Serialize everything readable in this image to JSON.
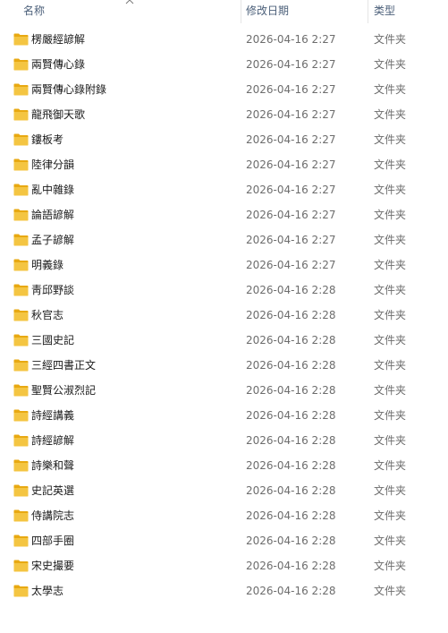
{
  "columns": {
    "name": "名称",
    "date": "修改日期",
    "type": "类型"
  },
  "folder_icon": "folder-icon",
  "folder_color": "#f4c542",
  "files": [
    {
      "name": "楞嚴經諺解",
      "date": "2026-04-16 2:27",
      "type": "文件夹"
    },
    {
      "name": "兩賢傳心錄",
      "date": "2026-04-16 2:27",
      "type": "文件夹"
    },
    {
      "name": "兩賢傳心錄附錄",
      "date": "2026-04-16 2:27",
      "type": "文件夹"
    },
    {
      "name": "龍飛御天歌",
      "date": "2026-04-16 2:27",
      "type": "文件夹"
    },
    {
      "name": "鏤板考",
      "date": "2026-04-16 2:27",
      "type": "文件夹"
    },
    {
      "name": "陸律分韻",
      "date": "2026-04-16 2:27",
      "type": "文件夹"
    },
    {
      "name": "亂中雜錄",
      "date": "2026-04-16 2:27",
      "type": "文件夹"
    },
    {
      "name": "論語諺解",
      "date": "2026-04-16 2:27",
      "type": "文件夹"
    },
    {
      "name": "孟子諺解",
      "date": "2026-04-16 2:27",
      "type": "文件夹"
    },
    {
      "name": "明義錄",
      "date": "2026-04-16 2:27",
      "type": "文件夹"
    },
    {
      "name": "靑邱野談",
      "date": "2026-04-16 2:28",
      "type": "文件夹"
    },
    {
      "name": "秋官志",
      "date": "2026-04-16 2:28",
      "type": "文件夹"
    },
    {
      "name": "三國史記",
      "date": "2026-04-16 2:28",
      "type": "文件夹"
    },
    {
      "name": "三經四書正文",
      "date": "2026-04-16 2:28",
      "type": "文件夹"
    },
    {
      "name": "聖賢公淑烈記",
      "date": "2026-04-16 2:28",
      "type": "文件夹"
    },
    {
      "name": "詩經講義",
      "date": "2026-04-16 2:28",
      "type": "文件夹"
    },
    {
      "name": "詩經諺解",
      "date": "2026-04-16 2:28",
      "type": "文件夹"
    },
    {
      "name": "詩樂和聲",
      "date": "2026-04-16 2:28",
      "type": "文件夹"
    },
    {
      "name": "史記英選",
      "date": "2026-04-16 2:28",
      "type": "文件夹"
    },
    {
      "name": "侍講院志",
      "date": "2026-04-16 2:28",
      "type": "文件夹"
    },
    {
      "name": "四部手圈",
      "date": "2026-04-16 2:28",
      "type": "文件夹"
    },
    {
      "name": "宋史撮要",
      "date": "2026-04-16 2:28",
      "type": "文件夹"
    },
    {
      "name": "太學志",
      "date": "2026-04-16 2:28",
      "type": "文件夹"
    }
  ]
}
